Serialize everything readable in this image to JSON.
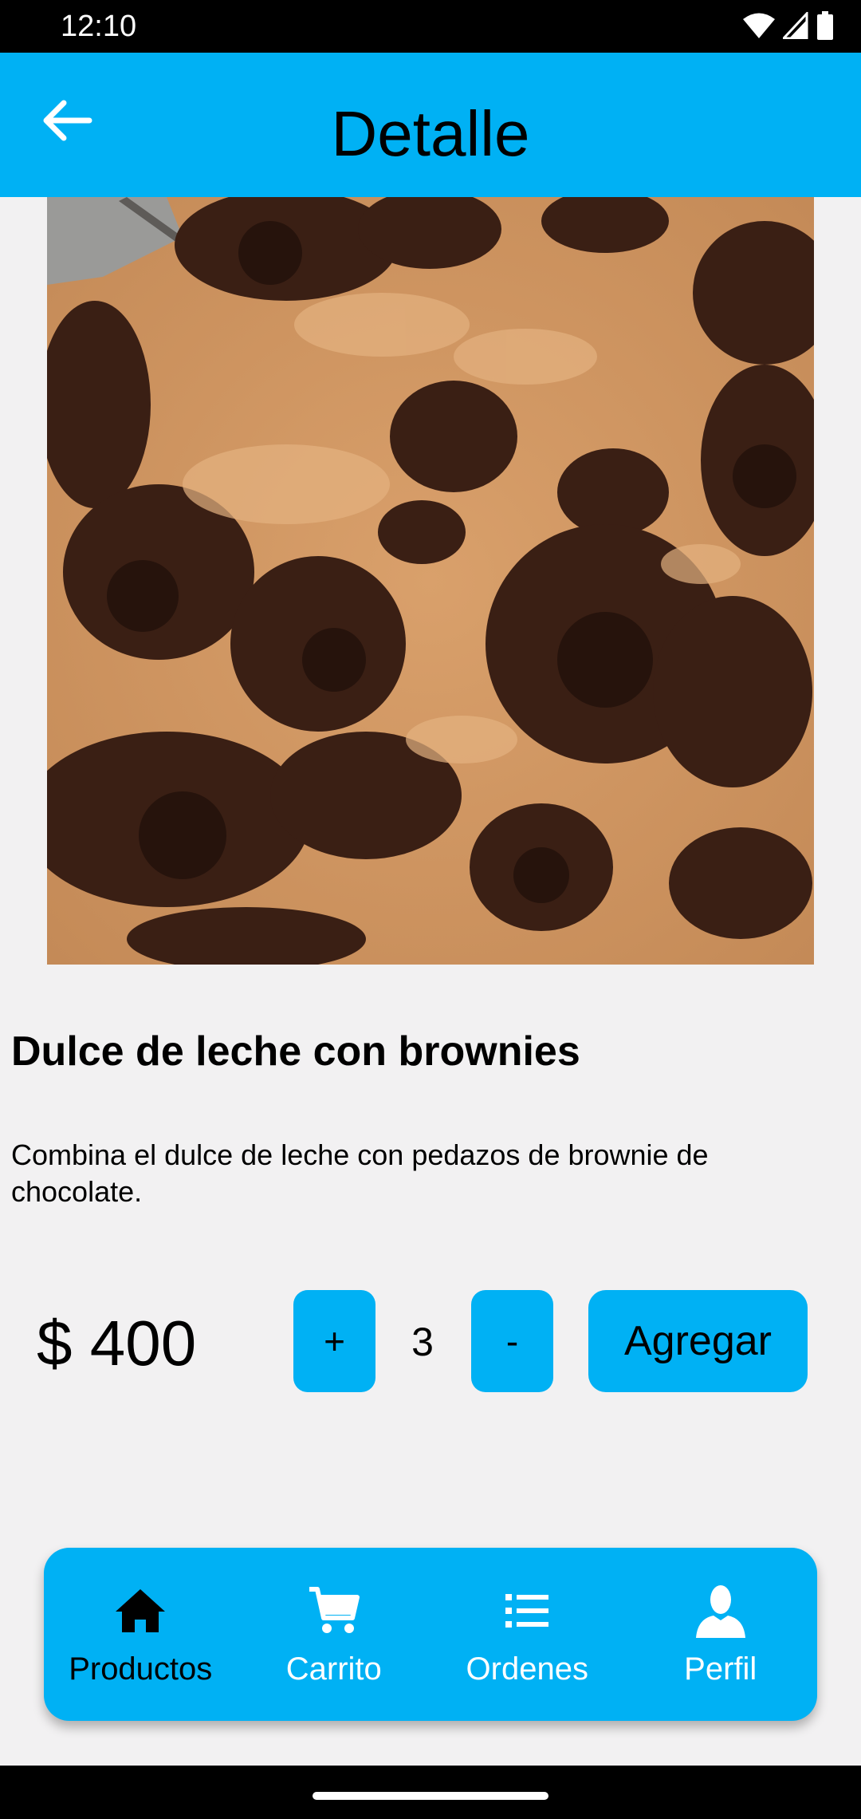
{
  "status_bar": {
    "time": "12:10",
    "icons": [
      "wifi-icon",
      "signal-icon",
      "battery-icon"
    ]
  },
  "app_bar": {
    "title": "Detalle",
    "back_icon": "arrow-back-icon"
  },
  "product": {
    "name": "Dulce de leche con brownies",
    "description": "Combina el dulce de leche con pedazos de brownie de chocolate.",
    "price": "$ 400",
    "quantity": "3"
  },
  "controls": {
    "increment_label": "+",
    "decrement_label": "-",
    "add_label": "Agregar"
  },
  "bottom_nav": {
    "items": [
      {
        "label": "Productos",
        "icon": "home-icon",
        "active": true
      },
      {
        "label": "Carrito",
        "icon": "cart-icon",
        "active": false
      },
      {
        "label": "Ordenes",
        "icon": "list-icon",
        "active": false
      },
      {
        "label": "Perfil",
        "icon": "person-icon",
        "active": false
      }
    ]
  },
  "colors": {
    "accent": "#00b1f4",
    "background": "#f2f1f2",
    "active_nav": "#000000",
    "inactive_nav": "#ffffff"
  }
}
